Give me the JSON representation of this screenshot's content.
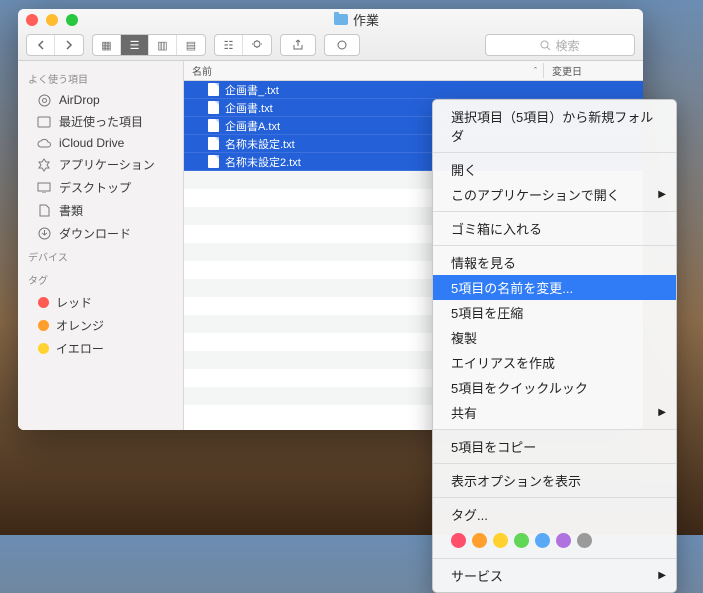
{
  "window": {
    "title": "作業"
  },
  "toolbar": {
    "search_placeholder": "検索"
  },
  "sidebar": {
    "sections": [
      {
        "header": "よく使う項目",
        "items": [
          "AirDrop",
          "最近使った項目",
          "iCloud Drive",
          "アプリケーション",
          "デスクトップ",
          "書類",
          "ダウンロード"
        ]
      },
      {
        "header": "デバイス",
        "items": []
      },
      {
        "header": "タグ",
        "items": [
          "レッド",
          "オレンジ",
          "イエロー"
        ]
      }
    ],
    "tag_colors": [
      "#ff5b52",
      "#ff9e2c",
      "#ffd22f"
    ]
  },
  "columns": {
    "name": "名前",
    "date": "変更日"
  },
  "files": [
    "企画書_.txt",
    "企画書.txt",
    "企画書A.txt",
    "名称未設定.txt",
    "名称未設定2.txt"
  ],
  "context_menu": {
    "groups": [
      [
        {
          "label": "選択項目（5項目）から新規フォルダ"
        }
      ],
      [
        {
          "label": "開く"
        },
        {
          "label": "このアプリケーションで開く",
          "sub": true
        }
      ],
      [
        {
          "label": "ゴミ箱に入れる"
        }
      ],
      [
        {
          "label": "情報を見る"
        },
        {
          "label": "5項目の名前を変更...",
          "hi": true
        },
        {
          "label": "5項目を圧縮"
        },
        {
          "label": "複製"
        },
        {
          "label": "エイリアスを作成"
        },
        {
          "label": "5項目をクイックルック"
        },
        {
          "label": "共有",
          "sub": true
        }
      ],
      [
        {
          "label": "5項目をコピー"
        }
      ],
      [
        {
          "label": "表示オプションを表示"
        }
      ],
      [
        {
          "label": "タグ..."
        }
      ]
    ],
    "tag_colors": [
      "#ff4f6a",
      "#ff9f2d",
      "#ffd22f",
      "#62d657",
      "#5aa9f6",
      "#af72de",
      "#9a9a9a"
    ],
    "service": "サービス"
  }
}
